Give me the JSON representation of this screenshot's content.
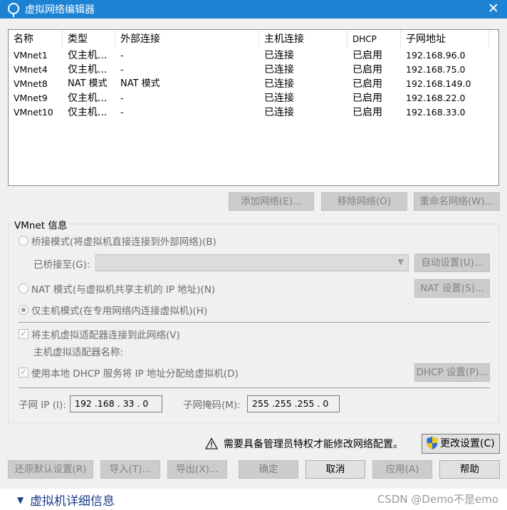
{
  "window": {
    "title": "虚拟网络编辑器",
    "close": "✕"
  },
  "table": {
    "headers": {
      "name": "名称",
      "type": "类型",
      "external": "外部连接",
      "host": "主机连接",
      "dhcp": "DHCP",
      "subnet": "子网地址"
    },
    "rows": [
      {
        "name": "VMnet1",
        "type": "仅主机...",
        "external": "-",
        "host": "已连接",
        "dhcp": "已启用",
        "subnet": "192.168.96.0"
      },
      {
        "name": "VMnet4",
        "type": "仅主机...",
        "external": "-",
        "host": "已连接",
        "dhcp": "已启用",
        "subnet": "192.168.75.0"
      },
      {
        "name": "VMnet8",
        "type": "NAT 模式",
        "external": "NAT 模式",
        "host": "已连接",
        "dhcp": "已启用",
        "subnet": "192.168.149.0"
      },
      {
        "name": "VMnet9",
        "type": "仅主机...",
        "external": "-",
        "host": "已连接",
        "dhcp": "已启用",
        "subnet": "192.168.22.0"
      },
      {
        "name": "VMnet10",
        "type": "仅主机...",
        "external": "-",
        "host": "已连接",
        "dhcp": "已启用",
        "subnet": "192.168.33.0"
      }
    ]
  },
  "list_buttons": {
    "add": "添加网络(E)...",
    "remove": "移除网络(O)",
    "rename": "重命名网络(W)..."
  },
  "vmnet_info": {
    "group_title": "VMnet 信息",
    "bridge_label": "桥接模式(将虚拟机直接连接到外部网络)(B)",
    "bridged_to_label": "已桥接至(G):",
    "auto_settings": "自动设置(U)...",
    "nat_label": "NAT 模式(与虚拟机共享主机的 IP 地址)(N)",
    "nat_settings": "NAT 设置(S)...",
    "host_only_label": "仅主机模式(在专用网络内连接虚拟机)(H)",
    "connect_adapter_label": "将主机虚拟适配器连接到此网络(V)",
    "adapter_name_label": "主机虚拟适配器名称:",
    "dhcp_label": "使用本地 DHCP 服务将 IP 地址分配给虚拟机(D)",
    "dhcp_settings": "DHCP 设置(P)...",
    "subnet_ip_label": "子网 IP (I):",
    "subnet_ip": "192 .168 . 33 . 0",
    "subnet_mask_label": "子网掩码(M):",
    "subnet_mask": "255 .255 .255 . 0"
  },
  "admin": {
    "notice": "需要具备管理员特权才能修改网络配置。",
    "change_settings": "更改设置(C)"
  },
  "footer_buttons": {
    "restore": "还原默认设置(R)",
    "import": "导入(T)...",
    "export": "导出(X)...",
    "ok": "确定",
    "cancel": "取消",
    "apply": "应用(A)",
    "help": "帮助"
  },
  "background": {
    "details": "虚拟机详细信息",
    "watermark": "CSDN @Demo不是emo"
  },
  "colors": {
    "titlebar": "#1c82d4",
    "dialog_bg": "#f0f0f0",
    "link_blue": "#1a3c8a"
  },
  "icons": {
    "app": "network-globe-icon",
    "close": "close-icon",
    "warning": "warning-triangle-icon",
    "shield": "uac-shield-icon",
    "expand": "triangle-down-icon"
  }
}
